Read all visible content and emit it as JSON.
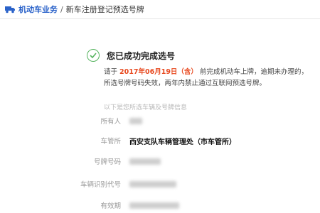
{
  "breadcrumb": {
    "root": "机动车业务",
    "separator": "/",
    "current": "新车注册登记预选号牌"
  },
  "success": {
    "title": "您已成功完成选号",
    "prefix": "请于",
    "date": "2017年06月19日（含）",
    "suffix": "前完成机动车上牌，逾期未办理的，所选号牌号码失效，两年内禁止通过互联网预选号牌。"
  },
  "info": {
    "section_title": "以下是您所选车辆及号牌信息",
    "fields": [
      {
        "label": "所有人",
        "value": ""
      },
      {
        "label": "车管所",
        "value": "西安支队车辆管理处（市车管所）"
      },
      {
        "label": "号牌号码",
        "value": ""
      },
      {
        "label": "车辆识别代号",
        "value": ""
      },
      {
        "label": "有效期",
        "value": ""
      }
    ]
  },
  "colors": {
    "accent": "#2a62c9",
    "success": "#55b35e",
    "highlight": "#e8491f"
  },
  "icons": {
    "breadcrumb": "car-icon",
    "success": "checkmark-circle-icon"
  }
}
